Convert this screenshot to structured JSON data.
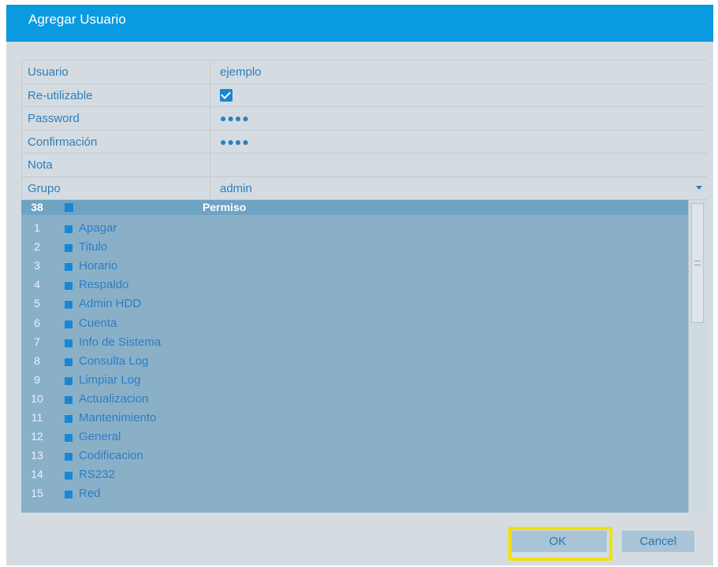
{
  "dialog": {
    "title": "Agregar Usuario"
  },
  "form": {
    "rows": [
      {
        "label": "Usuario",
        "value": "ejemplo"
      },
      {
        "label": "Re-utilizable",
        "checked": true
      },
      {
        "label": "Password",
        "value": "●●●●"
      },
      {
        "label": "Confirmación",
        "value": "●●●●"
      },
      {
        "label": "Nota",
        "value": ""
      },
      {
        "label": "Grupo",
        "value": "admin"
      }
    ]
  },
  "permissions": {
    "count": "38",
    "header": "Permiso",
    "items": [
      {
        "num": "1",
        "name": "Apagar"
      },
      {
        "num": "2",
        "name": "Titulo"
      },
      {
        "num": "3",
        "name": "Horario"
      },
      {
        "num": "4",
        "name": "Respaldo"
      },
      {
        "num": "5",
        "name": "Admin HDD"
      },
      {
        "num": "6",
        "name": "Cuenta"
      },
      {
        "num": "7",
        "name": "Info de Sistema"
      },
      {
        "num": "8",
        "name": "Consulta Log"
      },
      {
        "num": "9",
        "name": "Limpiar Log"
      },
      {
        "num": "10",
        "name": "Actualizacion"
      },
      {
        "num": "11",
        "name": "Mantenimiento"
      },
      {
        "num": "12",
        "name": "General"
      },
      {
        "num": "13",
        "name": "Codificacion"
      },
      {
        "num": "14",
        "name": "RS232"
      },
      {
        "num": "15",
        "name": "Red"
      }
    ]
  },
  "buttons": {
    "ok": "OK",
    "cancel": "Cancel"
  },
  "colors": {
    "titlebar": "#0a9ae0",
    "highlight": "#f4e100",
    "checkbox": "#1a86d6"
  }
}
